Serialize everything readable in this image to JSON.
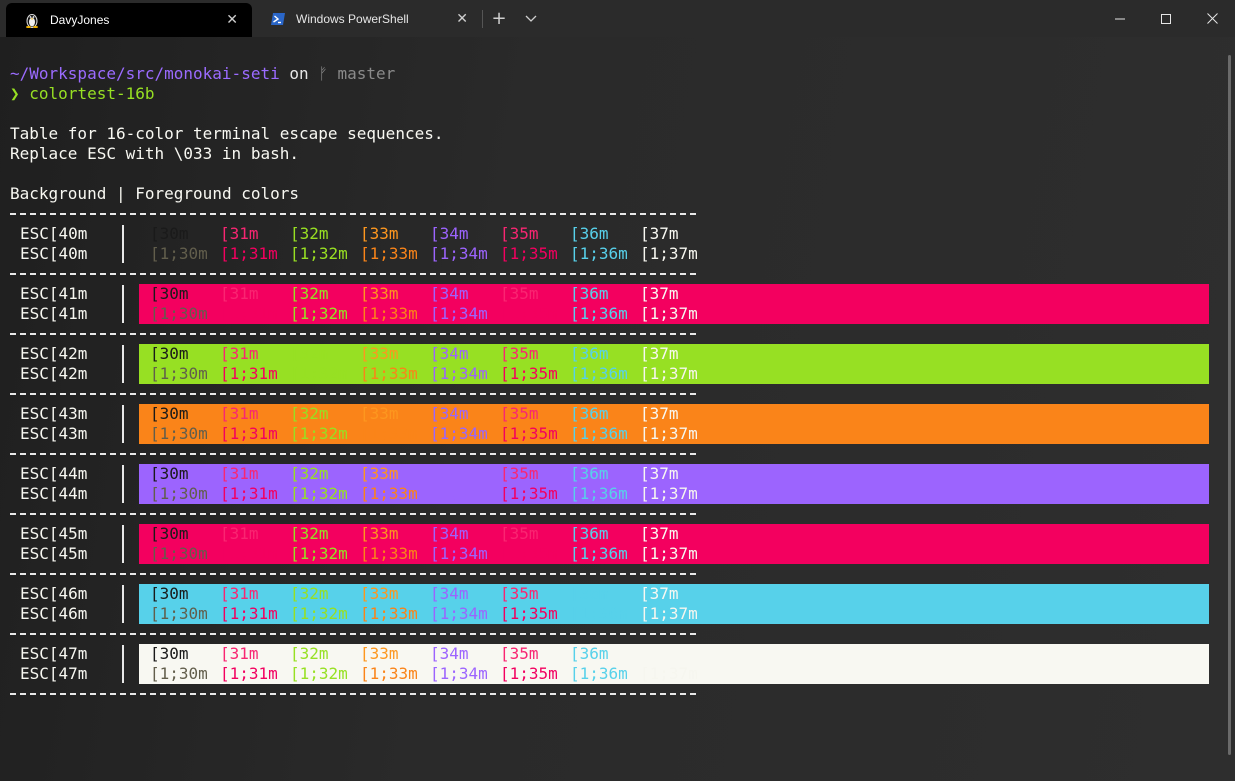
{
  "tabs": [
    {
      "label": "DavyJones",
      "icon": "linux-penguin-icon",
      "active": true
    },
    {
      "label": "Windows PowerShell",
      "icon": "powershell-icon",
      "active": false
    }
  ],
  "terminal": {
    "prompt_path": "~/Workspace/src/monokai-seti",
    "prompt_on": " on ",
    "branch_icon": "git-branch-icon",
    "branch": "master",
    "prompt_symbol": "❯",
    "command": "colortest-16b",
    "info_line_1": "Table for 16-color terminal escape sequences.",
    "info_line_2": "Replace ESC with \\033 in bash.",
    "header_background": "Background",
    "header_separator": "|",
    "header_foreground": "Foreground colors"
  },
  "palette": {
    "30": "#1a1a1a",
    "31": "#f92672",
    "32": "#97e023",
    "33": "#fd971f",
    "34": "#9c64fe",
    "35": "#f92672",
    "36": "#57d1ea",
    "37": "#f8f8f2",
    "b30": "#625e4c",
    "b31": "#f3005f",
    "b32": "#97e023",
    "b33": "#fa8419",
    "b34": "#9c64fe",
    "b35": "#f3005f",
    "b36": "#57d1ea",
    "b37": "#f6f6ef"
  },
  "fg_codes": [
    "30",
    "31",
    "32",
    "33",
    "34",
    "35",
    "36",
    "37"
  ],
  "bold_labels": [
    "[1;30m",
    "[1;31m",
    "[1;32m",
    "[1;33m",
    "[1;34m",
    "[1;35m",
    "[1;36m",
    "[1;37m"
  ],
  "normal_labels": [
    "[30m",
    "[31m",
    "[32m",
    "[33m",
    "[34m",
    "[35m",
    "[36m",
    "[37m"
  ],
  "rows": [
    {
      "esc": "ESC[40m",
      "bg": null
    },
    {
      "esc": "ESC[41m",
      "bg": "#f3005f"
    },
    {
      "esc": "ESC[42m",
      "bg": "#97e023"
    },
    {
      "esc": "ESC[43m",
      "bg": "#fa8419"
    },
    {
      "esc": "ESC[44m",
      "bg": "#9c64fe"
    },
    {
      "esc": "ESC[45m",
      "bg": "#f3005f"
    },
    {
      "esc": "ESC[46m",
      "bg": "#57d1ea"
    },
    {
      "esc": "ESC[47m",
      "bg": "#f8f8f2"
    }
  ]
}
